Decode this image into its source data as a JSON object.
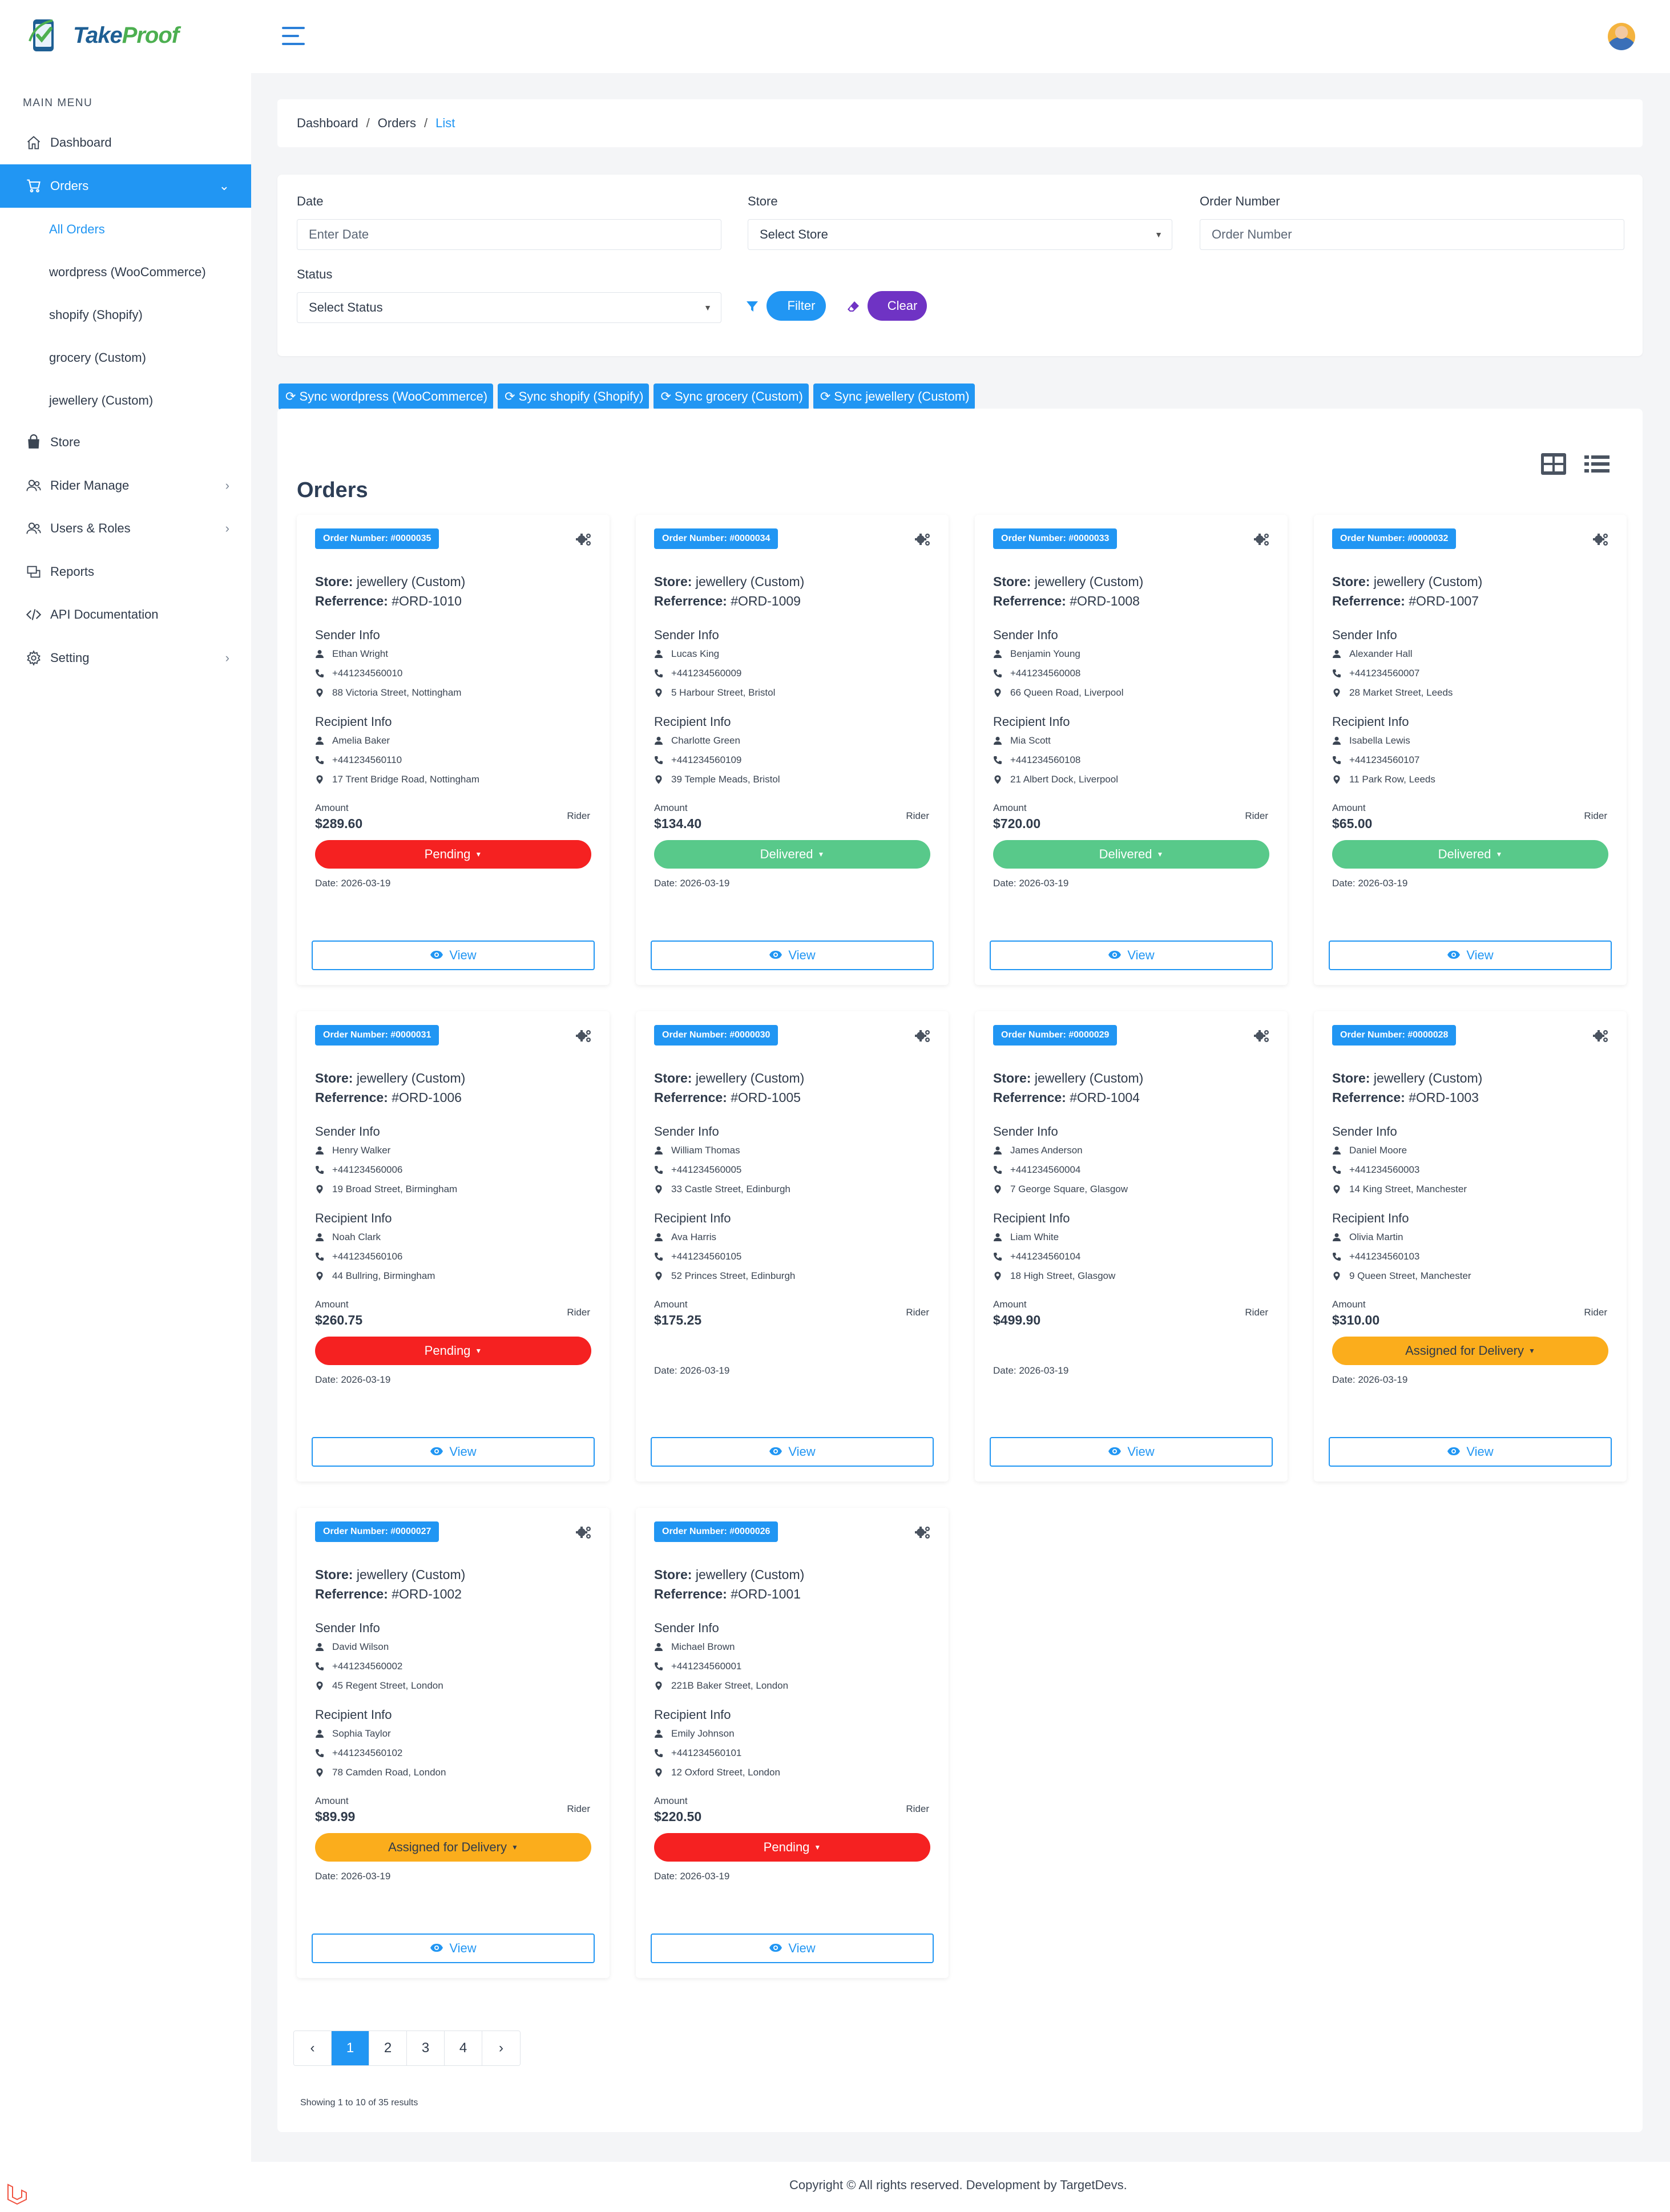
{
  "app": {
    "logo_main": "Take",
    "logo_accent": "Proof"
  },
  "sidebar": {
    "title": "MAIN MENU",
    "items": [
      {
        "label": "Dashboard",
        "icon": "home-icon"
      },
      {
        "label": "Orders",
        "icon": "cart-icon"
      },
      {
        "label": "Store",
        "icon": "store-icon"
      },
      {
        "label": "Rider Manage",
        "icon": "users-icon"
      },
      {
        "label": "Users & Roles",
        "icon": "users-icon"
      },
      {
        "label": "Reports",
        "icon": "reports-icon"
      },
      {
        "label": "API Documentation",
        "icon": "code-icon"
      },
      {
        "label": "Setting",
        "icon": "gear-icon"
      }
    ],
    "sub_items": [
      {
        "label": "All Orders"
      },
      {
        "label": "wordpress (WooCommerce)"
      },
      {
        "label": "shopify (Shopify)"
      },
      {
        "label": "grocery (Custom)"
      },
      {
        "label": "jewellery (Custom)"
      }
    ]
  },
  "breadcrumb": {
    "a": "Dashboard",
    "b": "Orders",
    "c": "List"
  },
  "filters": {
    "date_label": "Date",
    "date_placeholder": "Enter Date",
    "store_label": "Store",
    "store_value": "Select Store",
    "order_label": "Order Number",
    "order_placeholder": "Order Number",
    "status_label": "Status",
    "status_value": "Select Status",
    "filter_btn": "Filter",
    "clear_btn": "Clear"
  },
  "sync_buttons": [
    {
      "label": "Sync wordpress (WooCommerce)"
    },
    {
      "label": "Sync shopify (Shopify)"
    },
    {
      "label": "Sync grocery (Custom)"
    },
    {
      "label": "Sync jewellery (Custom)"
    }
  ],
  "orders": {
    "title": "Orders",
    "labels": {
      "store": "Store:",
      "ref": "Referrence:",
      "sender": "Sender Info",
      "recipient": "Recipient Info",
      "amount": "Amount",
      "rider": "Rider",
      "view": "View"
    },
    "items": [
      {
        "number": "Order Number: #0000035",
        "store": "jewellery (Custom)",
        "ref": "#ORD-1010",
        "s_name": "Ethan Wright",
        "s_phone": "+441234560010",
        "s_addr": "88 Victoria Street, Nottingham",
        "r_name": "Amelia Baker",
        "r_phone": "+441234560110",
        "r_addr": "17 Trent Bridge Road, Nottingham",
        "amount": "$289.60",
        "status": "Pending",
        "status_type": "pending",
        "date": "Date: 2026-03-19"
      },
      {
        "number": "Order Number: #0000034",
        "store": "jewellery (Custom)",
        "ref": "#ORD-1009",
        "s_name": "Lucas King",
        "s_phone": "+441234560009",
        "s_addr": "5 Harbour Street, Bristol",
        "r_name": "Charlotte Green",
        "r_phone": "+441234560109",
        "r_addr": "39 Temple Meads, Bristol",
        "amount": "$134.40",
        "status": "Delivered",
        "status_type": "delivered",
        "date": "Date: 2026-03-19"
      },
      {
        "number": "Order Number: #0000033",
        "store": "jewellery (Custom)",
        "ref": "#ORD-1008",
        "s_name": "Benjamin Young",
        "s_phone": "+441234560008",
        "s_addr": "66 Queen Road, Liverpool",
        "r_name": "Mia Scott",
        "r_phone": "+441234560108",
        "r_addr": "21 Albert Dock, Liverpool",
        "amount": "$720.00",
        "status": "Delivered",
        "status_type": "delivered",
        "date": "Date: 2026-03-19"
      },
      {
        "number": "Order Number: #0000032",
        "store": "jewellery (Custom)",
        "ref": "#ORD-1007",
        "s_name": "Alexander Hall",
        "s_phone": "+441234560007",
        "s_addr": "28 Market Street, Leeds",
        "r_name": "Isabella Lewis",
        "r_phone": "+441234560107",
        "r_addr": "11 Park Row, Leeds",
        "amount": "$65.00",
        "status": "Delivered",
        "status_type": "delivered",
        "date": "Date: 2026-03-19"
      },
      {
        "number": "Order Number: #0000031",
        "store": "jewellery (Custom)",
        "ref": "#ORD-1006",
        "s_name": "Henry Walker",
        "s_phone": "+441234560006",
        "s_addr": "19 Broad Street, Birmingham",
        "r_name": "Noah Clark",
        "r_phone": "+441234560106",
        "r_addr": "44 Bullring, Birmingham",
        "amount": "$260.75",
        "status": "Pending",
        "status_type": "pending",
        "date": "Date: 2026-03-19"
      },
      {
        "number": "Order Number: #0000030",
        "store": "jewellery (Custom)",
        "ref": "#ORD-1005",
        "s_name": "William Thomas",
        "s_phone": "+441234560005",
        "s_addr": "33 Castle Street, Edinburgh",
        "r_name": "Ava Harris",
        "r_phone": "+441234560105",
        "r_addr": "52 Princes Street, Edinburgh",
        "amount": "$175.25",
        "status": "",
        "status_type": "none",
        "date": "Date: 2026-03-19"
      },
      {
        "number": "Order Number: #0000029",
        "store": "jewellery (Custom)",
        "ref": "#ORD-1004",
        "s_name": "James Anderson",
        "s_phone": "+441234560004",
        "s_addr": "7 George Square, Glasgow",
        "r_name": "Liam White",
        "r_phone": "+441234560104",
        "r_addr": "18 High Street, Glasgow",
        "amount": "$499.90",
        "status": "",
        "status_type": "none",
        "date": "Date: 2026-03-19"
      },
      {
        "number": "Order Number: #0000028",
        "store": "jewellery (Custom)",
        "ref": "#ORD-1003",
        "s_name": "Daniel Moore",
        "s_phone": "+441234560003",
        "s_addr": "14 King Street, Manchester",
        "r_name": "Olivia Martin",
        "r_phone": "+441234560103",
        "r_addr": "9 Queen Street, Manchester",
        "amount": "$310.00",
        "status": "Assigned for Delivery",
        "status_type": "assigned",
        "date": "Date: 2026-03-19"
      },
      {
        "number": "Order Number: #0000027",
        "store": "jewellery (Custom)",
        "ref": "#ORD-1002",
        "s_name": "David Wilson",
        "s_phone": "+441234560002",
        "s_addr": "45 Regent Street, London",
        "r_name": "Sophia Taylor",
        "r_phone": "+441234560102",
        "r_addr": "78 Camden Road, London",
        "amount": "$89.99",
        "status": "Assigned for Delivery",
        "status_type": "assigned",
        "date": "Date: 2026-03-19"
      },
      {
        "number": "Order Number: #0000026",
        "store": "jewellery (Custom)",
        "ref": "#ORD-1001",
        "s_name": "Michael Brown",
        "s_phone": "+441234560001",
        "s_addr": "221B Baker Street, London",
        "r_name": "Emily Johnson",
        "r_phone": "+441234560101",
        "r_addr": "12 Oxford Street, London",
        "amount": "$220.50",
        "status": "Pending",
        "status_type": "pending",
        "date": "Date: 2026-03-19"
      }
    ]
  },
  "pagination": {
    "prev": "‹",
    "pages": [
      "1",
      "2",
      "3",
      "4"
    ],
    "next": "›",
    "current": "1",
    "showing": "Showing 1 to 10 of 35 results"
  },
  "footer": {
    "text": "Copyright © All rights reserved. Development by TargetDevs."
  },
  "colors": {
    "primary": "#2196f3",
    "pending": "#f52121",
    "delivered": "#58c98a",
    "assigned": "#fbad1c",
    "clear": "#6f33c4"
  }
}
